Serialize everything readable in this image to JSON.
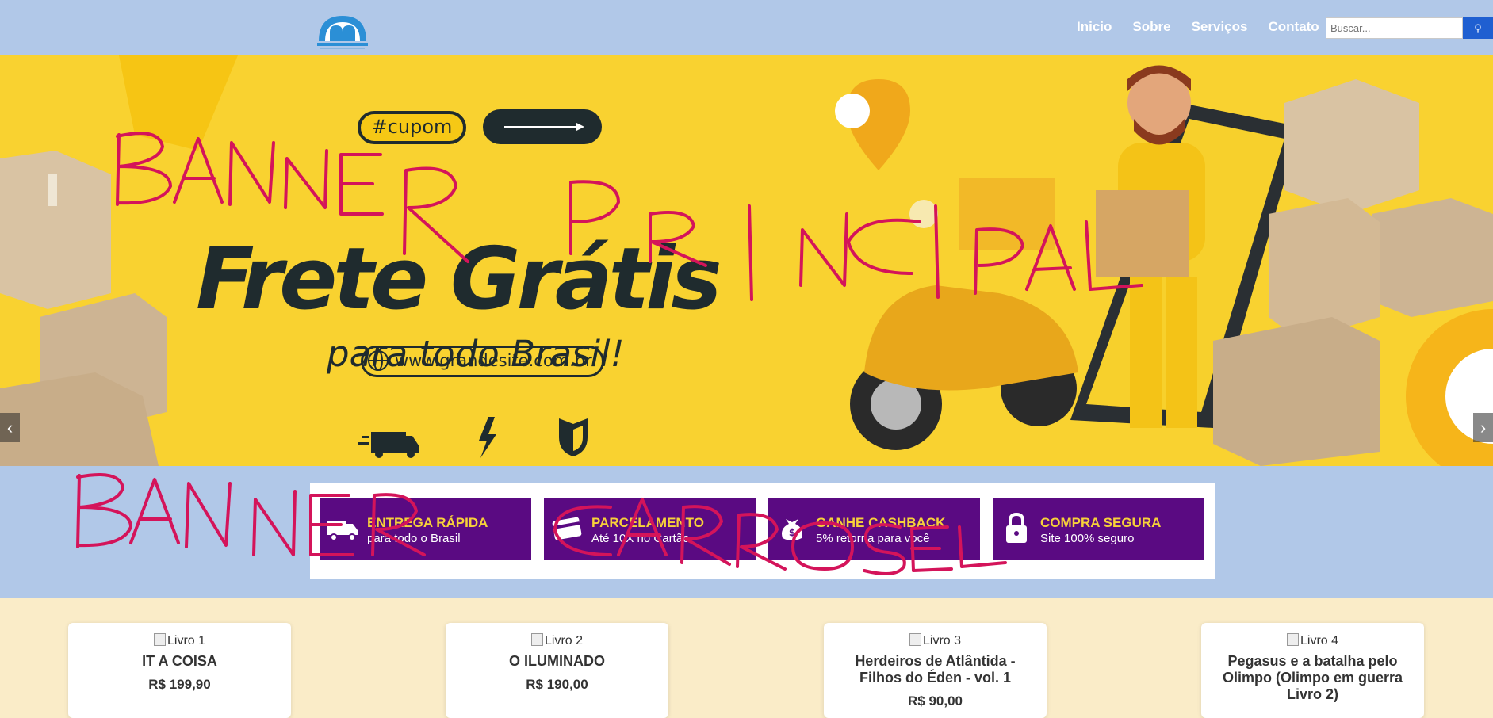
{
  "header": {
    "nav": [
      "Inicio",
      "Sobre",
      "Serviços",
      "Contato"
    ],
    "search_placeholder": "Buscar...",
    "search_button_icon": "search-icon"
  },
  "banner": {
    "tag": "#cupom",
    "headline": "Frete Grátis",
    "subheadline": "para todo Brasil!",
    "url": "www.grandesite.com.br",
    "prev": "‹",
    "next": "›",
    "icons": [
      "truck-icon",
      "lightning-icon",
      "shield-icon",
      "location-pin-icon"
    ],
    "colors": {
      "background": "#f9d230",
      "text": "#1f2b2e"
    }
  },
  "features": [
    {
      "icon": "truck-icon",
      "title": "ENTREGA RÁPIDA",
      "subtitle": "para todo o Brasil"
    },
    {
      "icon": "credit-card-icon",
      "title": "PARCELAMENTO",
      "subtitle": "Até 10X no Cartão"
    },
    {
      "icon": "money-bag-icon",
      "title": "GANHE CASHBACK",
      "subtitle": "5% retorna para você"
    },
    {
      "icon": "lock-icon",
      "title": "COMPRA SEGURA",
      "subtitle": "Site 100% seguro"
    }
  ],
  "products": [
    {
      "alt": "Livro 1",
      "name": "IT A COISA",
      "price": "R$ 199,90"
    },
    {
      "alt": "Livro 2",
      "name": "O ILUMINADO",
      "price": "R$ 190,00"
    },
    {
      "alt": "Livro 3",
      "name": "Herdeiros de Atlântida - Filhos do Éden - vol. 1",
      "price": "R$ 90,00"
    },
    {
      "alt": "Livro 4",
      "name": "Pegasus e a batalha pelo Olimpo (Olimpo em guerra Livro 2)",
      "price": ""
    }
  ],
  "annotations": [
    "BANNER PRINCIPAL",
    "BANNER CARROSSEL"
  ],
  "colors": {
    "header": "#b1c8e8",
    "accent": "#5a0a82",
    "feature_title": "#f7d13a",
    "page": "#faecc8",
    "annotation": "#d4145a"
  }
}
